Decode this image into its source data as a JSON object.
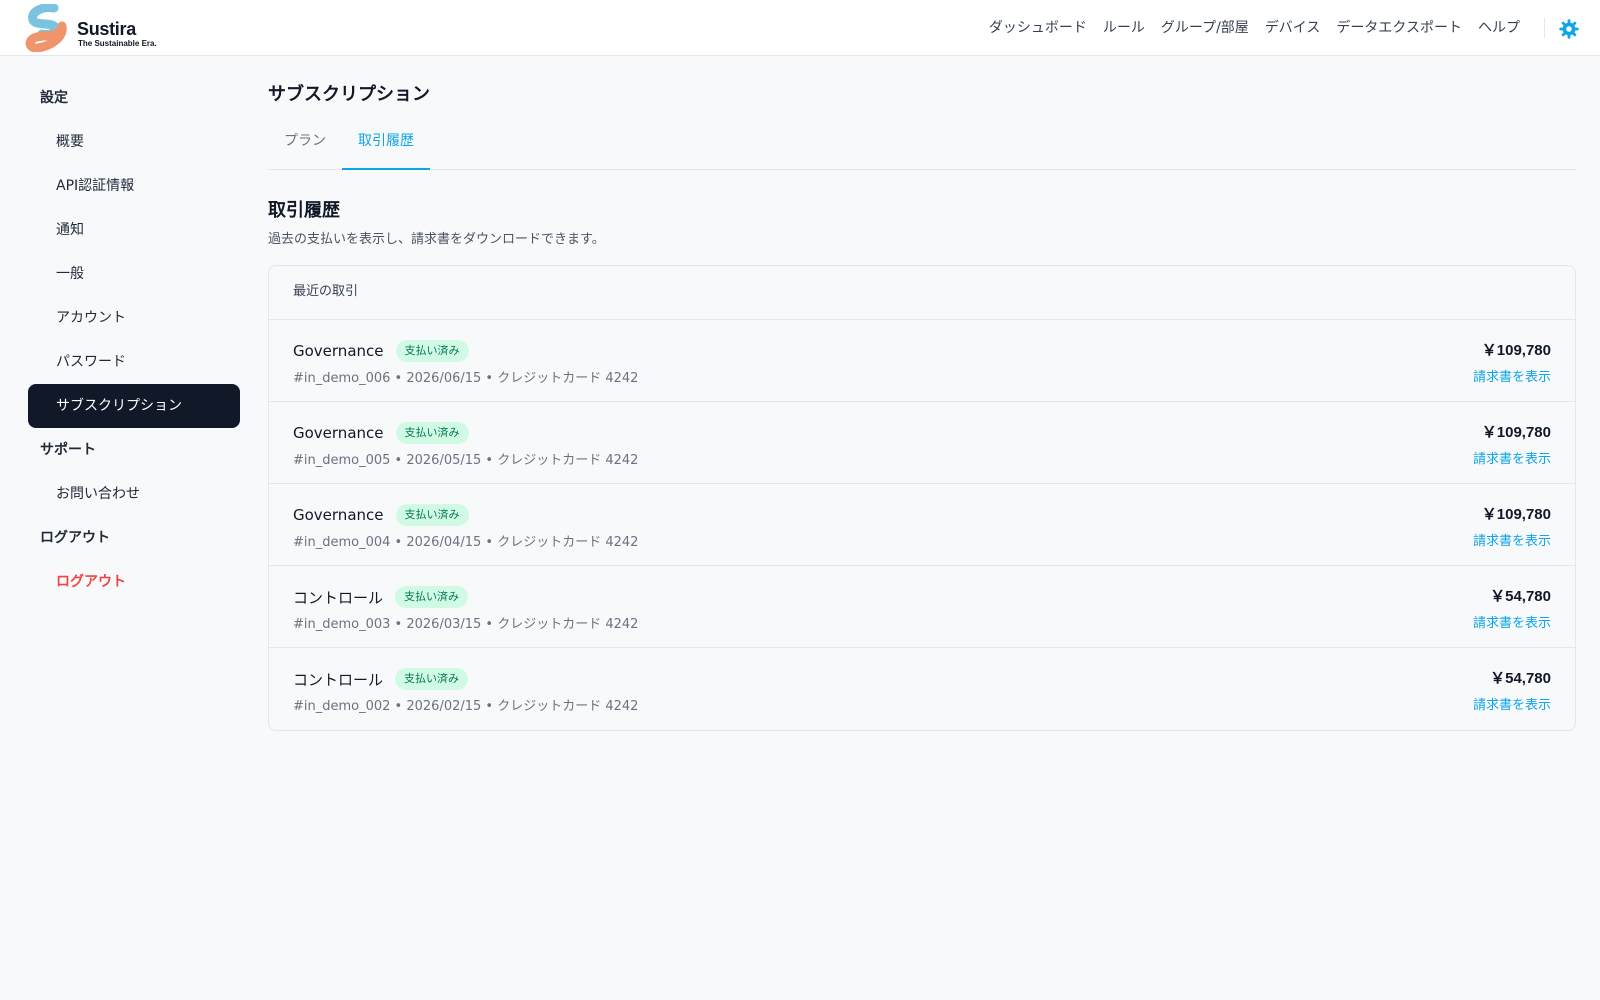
{
  "brand": {
    "name": "Sustira",
    "tagline": "The Sustainable Era."
  },
  "header": {
    "nav": [
      "ダッシュボード",
      "ルール",
      "グループ/部屋",
      "デバイス",
      "データエクスポート",
      "ヘルプ"
    ],
    "accent_color": "#0ea5e9"
  },
  "sidebar": {
    "settings_label": "設定",
    "items": [
      "概要",
      "API認証情報",
      "通知",
      "一般",
      "アカウント",
      "パスワード",
      "サブスクリプション"
    ],
    "support_label": "サポート",
    "support_items": [
      "お問い合わせ"
    ],
    "logout_section_label": "ログアウト",
    "logout_item": "ログアウト"
  },
  "main": {
    "title": "サブスクリプション",
    "tabs": [
      "プラン",
      "取引履歴"
    ],
    "active_tab": "取引履歴",
    "section_title": "取引履歴",
    "section_desc": "過去の支払いを表示し、請求書をダウンロードできます。",
    "card_title": "最近の取引",
    "transactions": [
      {
        "plan": "Governance",
        "status": "支払い済み",
        "meta": "#in_demo_006 • 2026/06/15 • クレジットカード 4242",
        "amount": "￥109,780",
        "link": "請求書を表示"
      },
      {
        "plan": "Governance",
        "status": "支払い済み",
        "meta": "#in_demo_005 • 2026/05/15 • クレジットカード 4242",
        "amount": "￥109,780",
        "link": "請求書を表示"
      },
      {
        "plan": "Governance",
        "status": "支払い済み",
        "meta": "#in_demo_004 • 2026/04/15 • クレジットカード 4242",
        "amount": "￥109,780",
        "link": "請求書を表示"
      },
      {
        "plan": "コントロール",
        "status": "支払い済み",
        "meta": "#in_demo_003 • 2026/03/15 • クレジットカード 4242",
        "amount": "￥54,780",
        "link": "請求書を表示"
      },
      {
        "plan": "コントロール",
        "status": "支払い済み",
        "meta": "#in_demo_002 • 2026/02/15 • クレジットカード 4242",
        "amount": "￥54,780",
        "link": "請求書を表示"
      }
    ]
  }
}
